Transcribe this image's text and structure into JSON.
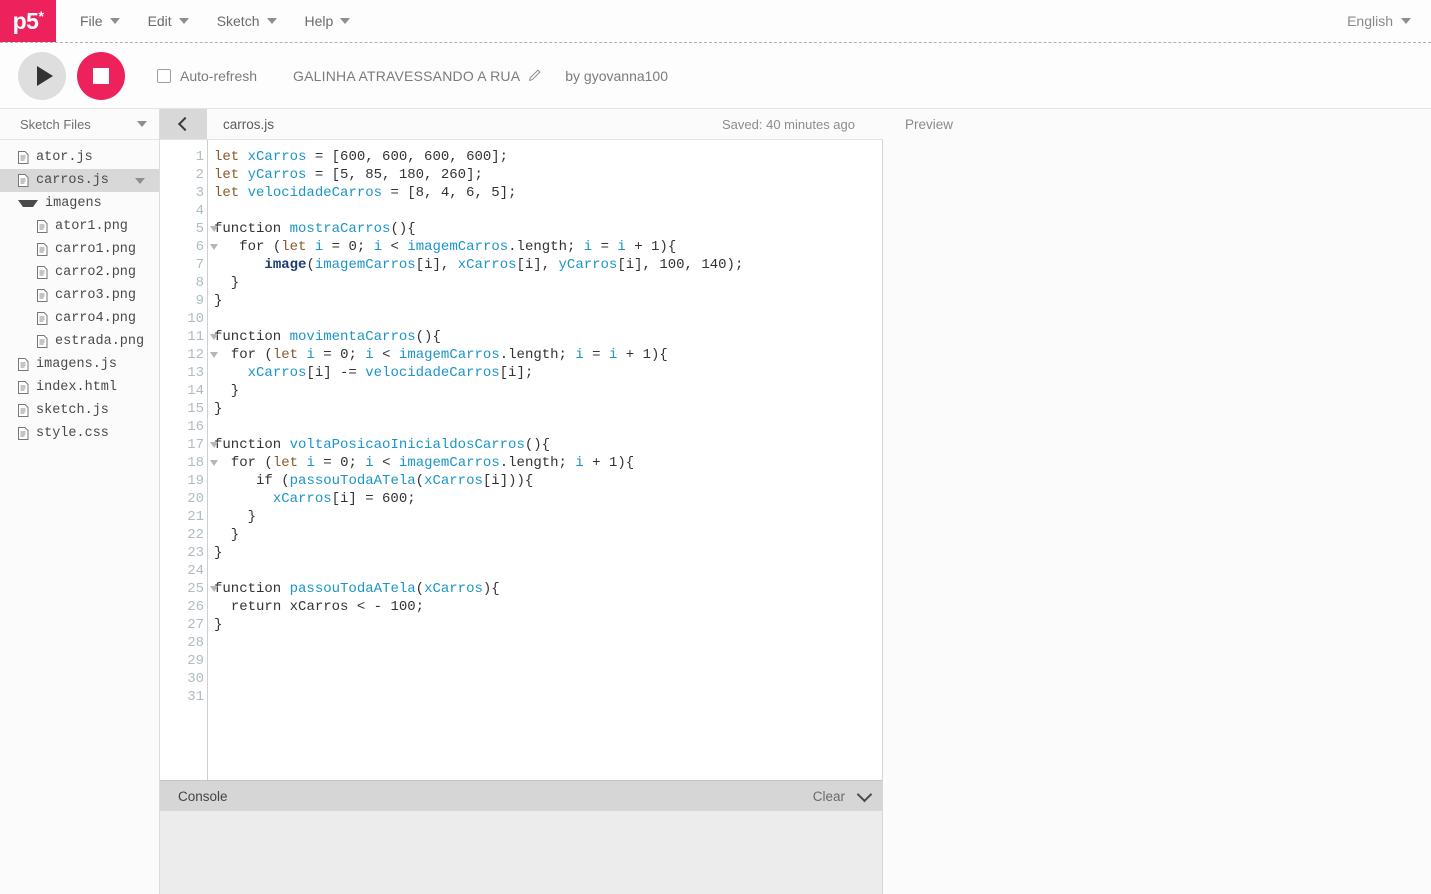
{
  "nav": {
    "logo": "p5",
    "logo_star": "*",
    "menus": [
      {
        "label": "File"
      },
      {
        "label": "Edit"
      },
      {
        "label": "Sketch"
      },
      {
        "label": "Help"
      }
    ],
    "language": "English"
  },
  "toolbar": {
    "play_label": "Play",
    "stop_label": "Stop",
    "autorefresh_label": "Auto-refresh",
    "autorefresh_checked": false,
    "sketch_name": "GALINHA ATRAVESSANDO A RUA",
    "author": "by gyovanna100"
  },
  "sidebar": {
    "header": "Sketch Files",
    "files": [
      {
        "name": "ator.js",
        "type": "file",
        "indent": 0,
        "selected": false,
        "caret": false
      },
      {
        "name": "carros.js",
        "type": "file",
        "indent": 0,
        "selected": true,
        "caret": true
      },
      {
        "name": "imagens",
        "type": "folder",
        "indent": 0,
        "selected": false,
        "caret": false
      },
      {
        "name": "ator1.png",
        "type": "file",
        "indent": 1,
        "selected": false,
        "caret": false
      },
      {
        "name": "carro1.png",
        "type": "file",
        "indent": 1,
        "selected": false,
        "caret": false
      },
      {
        "name": "carro2.png",
        "type": "file",
        "indent": 1,
        "selected": false,
        "caret": false
      },
      {
        "name": "carro3.png",
        "type": "file",
        "indent": 1,
        "selected": false,
        "caret": false
      },
      {
        "name": "carro4.png",
        "type": "file",
        "indent": 1,
        "selected": false,
        "caret": false
      },
      {
        "name": "estrada.png",
        "type": "file",
        "indent": 1,
        "selected": false,
        "caret": false
      },
      {
        "name": "imagens.js",
        "type": "file",
        "indent": 0,
        "selected": false,
        "caret": false
      },
      {
        "name": "index.html",
        "type": "file",
        "indent": 0,
        "selected": false,
        "caret": false
      },
      {
        "name": "sketch.js",
        "type": "file",
        "indent": 0,
        "selected": false,
        "caret": false
      },
      {
        "name": "style.css",
        "type": "file",
        "indent": 0,
        "selected": false,
        "caret": false
      }
    ]
  },
  "editor": {
    "collapse_label": "Collapse sidebar",
    "active_file": "carros.js",
    "saved_status": "Saved: 40 minutes ago",
    "total_lines": 31,
    "fold_lines": [
      5,
      6,
      11,
      12,
      17,
      18,
      25
    ],
    "lines": [
      {
        "n": 1,
        "tokens": [
          {
            "t": "kw",
            "v": "let"
          },
          {
            "t": "plain",
            "v": " "
          },
          {
            "t": "var",
            "v": "xCarros"
          },
          {
            "t": "plain",
            "v": " = [600, 600, 600, 600];"
          }
        ]
      },
      {
        "n": 2,
        "tokens": [
          {
            "t": "kw",
            "v": "let"
          },
          {
            "t": "plain",
            "v": " "
          },
          {
            "t": "var",
            "v": "yCarros"
          },
          {
            "t": "plain",
            "v": " = [5, 85, 180, 260];"
          }
        ]
      },
      {
        "n": 3,
        "tokens": [
          {
            "t": "kw",
            "v": "let"
          },
          {
            "t": "plain",
            "v": " "
          },
          {
            "t": "var",
            "v": "velocidadeCarros"
          },
          {
            "t": "plain",
            "v": " = [8, 4, 6, 5];"
          }
        ]
      },
      {
        "n": 4,
        "tokens": []
      },
      {
        "n": 5,
        "tokens": [
          {
            "t": "ctl",
            "v": "function"
          },
          {
            "t": "plain",
            "v": " "
          },
          {
            "t": "fn",
            "v": "mostraCarros"
          },
          {
            "t": "plain",
            "v": "(){"
          }
        ]
      },
      {
        "n": 6,
        "tokens": [
          {
            "t": "plain",
            "v": "   "
          },
          {
            "t": "ctl",
            "v": "for"
          },
          {
            "t": "plain",
            "v": " ("
          },
          {
            "t": "kw",
            "v": "let"
          },
          {
            "t": "plain",
            "v": " "
          },
          {
            "t": "var",
            "v": "i"
          },
          {
            "t": "plain",
            "v": " = 0; "
          },
          {
            "t": "var",
            "v": "i"
          },
          {
            "t": "plain",
            "v": " < "
          },
          {
            "t": "var",
            "v": "imagemCarros"
          },
          {
            "t": "plain",
            "v": ".length; "
          },
          {
            "t": "var",
            "v": "i"
          },
          {
            "t": "plain",
            "v": " = "
          },
          {
            "t": "var",
            "v": "i"
          },
          {
            "t": "plain",
            "v": " + 1){"
          }
        ]
      },
      {
        "n": 7,
        "tokens": [
          {
            "t": "plain",
            "v": "      "
          },
          {
            "t": "builtin",
            "v": "image"
          },
          {
            "t": "plain",
            "v": "("
          },
          {
            "t": "var",
            "v": "imagemCarros"
          },
          {
            "t": "plain",
            "v": "[i], "
          },
          {
            "t": "var",
            "v": "xCarros"
          },
          {
            "t": "plain",
            "v": "[i], "
          },
          {
            "t": "var",
            "v": "yCarros"
          },
          {
            "t": "plain",
            "v": "[i], 100, 140);"
          }
        ]
      },
      {
        "n": 8,
        "tokens": [
          {
            "t": "plain",
            "v": "  }"
          }
        ]
      },
      {
        "n": 9,
        "tokens": [
          {
            "t": "plain",
            "v": "}"
          }
        ]
      },
      {
        "n": 10,
        "tokens": []
      },
      {
        "n": 11,
        "tokens": [
          {
            "t": "ctl",
            "v": "function"
          },
          {
            "t": "plain",
            "v": " "
          },
          {
            "t": "fn",
            "v": "movimentaCarros"
          },
          {
            "t": "plain",
            "v": "(){"
          }
        ]
      },
      {
        "n": 12,
        "tokens": [
          {
            "t": "plain",
            "v": "  "
          },
          {
            "t": "ctl",
            "v": "for"
          },
          {
            "t": "plain",
            "v": " ("
          },
          {
            "t": "kw",
            "v": "let"
          },
          {
            "t": "plain",
            "v": " "
          },
          {
            "t": "var",
            "v": "i"
          },
          {
            "t": "plain",
            "v": " = 0; "
          },
          {
            "t": "var",
            "v": "i"
          },
          {
            "t": "plain",
            "v": " < "
          },
          {
            "t": "var",
            "v": "imagemCarros"
          },
          {
            "t": "plain",
            "v": ".length; "
          },
          {
            "t": "var",
            "v": "i"
          },
          {
            "t": "plain",
            "v": " = "
          },
          {
            "t": "var",
            "v": "i"
          },
          {
            "t": "plain",
            "v": " + 1){"
          }
        ]
      },
      {
        "n": 13,
        "tokens": [
          {
            "t": "plain",
            "v": "    "
          },
          {
            "t": "var",
            "v": "xCarros"
          },
          {
            "t": "plain",
            "v": "[i] -= "
          },
          {
            "t": "var",
            "v": "velocidadeCarros"
          },
          {
            "t": "plain",
            "v": "[i];"
          }
        ]
      },
      {
        "n": 14,
        "tokens": [
          {
            "t": "plain",
            "v": "  }"
          }
        ]
      },
      {
        "n": 15,
        "tokens": [
          {
            "t": "plain",
            "v": "}"
          }
        ]
      },
      {
        "n": 16,
        "tokens": []
      },
      {
        "n": 17,
        "tokens": [
          {
            "t": "ctl",
            "v": "function"
          },
          {
            "t": "plain",
            "v": " "
          },
          {
            "t": "fn",
            "v": "voltaPosicaoInicialdosCarros"
          },
          {
            "t": "plain",
            "v": "(){"
          }
        ]
      },
      {
        "n": 18,
        "tokens": [
          {
            "t": "plain",
            "v": "  "
          },
          {
            "t": "ctl",
            "v": "for"
          },
          {
            "t": "plain",
            "v": " ("
          },
          {
            "t": "kw",
            "v": "let"
          },
          {
            "t": "plain",
            "v": " "
          },
          {
            "t": "var",
            "v": "i"
          },
          {
            "t": "plain",
            "v": " = 0; "
          },
          {
            "t": "var",
            "v": "i"
          },
          {
            "t": "plain",
            "v": " < "
          },
          {
            "t": "var",
            "v": "imagemCarros"
          },
          {
            "t": "plain",
            "v": ".length; "
          },
          {
            "t": "var",
            "v": "i"
          },
          {
            "t": "plain",
            "v": " + 1){"
          }
        ]
      },
      {
        "n": 19,
        "tokens": [
          {
            "t": "plain",
            "v": "     "
          },
          {
            "t": "ctl",
            "v": "if"
          },
          {
            "t": "plain",
            "v": " ("
          },
          {
            "t": "fn",
            "v": "passouTodaATela"
          },
          {
            "t": "plain",
            "v": "("
          },
          {
            "t": "var",
            "v": "xCarros"
          },
          {
            "t": "plain",
            "v": "[i])){"
          }
        ]
      },
      {
        "n": 20,
        "tokens": [
          {
            "t": "plain",
            "v": "       "
          },
          {
            "t": "var",
            "v": "xCarros"
          },
          {
            "t": "plain",
            "v": "[i] = 600;"
          }
        ]
      },
      {
        "n": 21,
        "tokens": [
          {
            "t": "plain",
            "v": "    }"
          }
        ]
      },
      {
        "n": 22,
        "tokens": [
          {
            "t": "plain",
            "v": "  }"
          }
        ]
      },
      {
        "n": 23,
        "tokens": [
          {
            "t": "plain",
            "v": "}"
          }
        ]
      },
      {
        "n": 24,
        "tokens": []
      },
      {
        "n": 25,
        "tokens": [
          {
            "t": "ctl",
            "v": "function"
          },
          {
            "t": "plain",
            "v": " "
          },
          {
            "t": "fn",
            "v": "passouTodaATela"
          },
          {
            "t": "plain",
            "v": "("
          },
          {
            "t": "var",
            "v": "xCarros"
          },
          {
            "t": "plain",
            "v": "){"
          }
        ]
      },
      {
        "n": 26,
        "tokens": [
          {
            "t": "plain",
            "v": "  "
          },
          {
            "t": "ctl",
            "v": "return"
          },
          {
            "t": "plain",
            "v": " xCarros < - 100;"
          }
        ]
      },
      {
        "n": 27,
        "tokens": [
          {
            "t": "plain",
            "v": "}"
          }
        ]
      },
      {
        "n": 28,
        "tokens": []
      },
      {
        "n": 29,
        "tokens": []
      },
      {
        "n": 30,
        "tokens": []
      },
      {
        "n": 31,
        "tokens": []
      }
    ]
  },
  "console": {
    "title": "Console",
    "clear_label": "Clear"
  },
  "preview": {
    "title": "Preview"
  },
  "colors": {
    "brand_pink": "#ED225D",
    "play_gray": "#dedede",
    "selected_row": "#d8d8d8",
    "console_bar": "#d6d6d6",
    "syntax_keyword": "#8b5a2b",
    "syntax_variable": "#1b95c8",
    "syntax_builtin": "#1b3a73",
    "gutter_number": "#aebcc4"
  }
}
